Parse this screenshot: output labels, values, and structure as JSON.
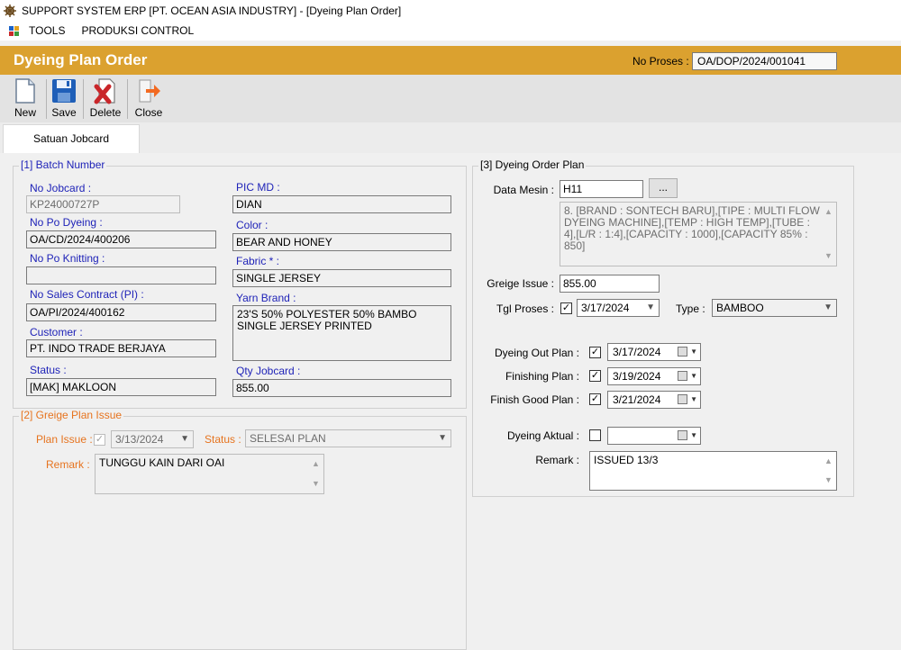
{
  "window": {
    "title": "SUPPORT SYSTEM ERP [PT. OCEAN ASIA INDUSTRY] - [Dyeing Plan Order]"
  },
  "menu": {
    "items": [
      "TOOLS",
      "PRODUKSI CONTROL"
    ]
  },
  "header": {
    "title": "Dyeing Plan Order",
    "no_proses_label": "No Proses :",
    "no_proses_value": "OA/DOP/2024/001041"
  },
  "toolbar": {
    "new": "New",
    "save": "Save",
    "delete": "Delete",
    "close": "Close"
  },
  "tabs": [
    "Satuan Jobcard"
  ],
  "batch": {
    "legend": "[1] Batch Number",
    "no_jobcard_label": "No Jobcard :",
    "no_jobcard": "KP24000727P",
    "no_po_dyeing_label": "No Po Dyeing :",
    "no_po_dyeing": "OA/CD/2024/400206",
    "no_po_knitting_label": "No Po Knitting :",
    "no_po_knitting": "",
    "no_sales_contract_label": "No Sales Contract (PI) :",
    "no_sales_contract": "OA/PI/2024/400162",
    "customer_label": "Customer :",
    "customer": "PT. INDO TRADE BERJAYA",
    "status_label": "Status :",
    "status": "[MAK] MAKLOON",
    "pic_md_label": "PIC MD :",
    "pic_md": "DIAN",
    "color_label": "Color :",
    "color": "BEAR AND HONEY",
    "fabric_label": "Fabric * :",
    "fabric": "SINGLE JERSEY",
    "yarn_brand_label": "Yarn Brand :",
    "yarn_brand": "23'S 50% POLYESTER 50% BAMBO SINGLE JERSEY PRINTED",
    "qty_jobcard_label": "Qty Jobcard :",
    "qty_jobcard": "855.00"
  },
  "greige": {
    "legend": "[2] Greige Plan Issue",
    "plan_issue_label": "Plan Issue :",
    "plan_issue_date": "3/13/2024",
    "status_label": "Status :",
    "status_value": "SELESAI PLAN",
    "remark_label": "Remark :",
    "remark": "TUNGGU KAIN DARI OAI"
  },
  "dyeing": {
    "legend": "[3] Dyeing Order Plan",
    "data_mesin_label": "Data Mesin :",
    "data_mesin": "H11",
    "ellipsis": "...",
    "mesin_desc": "8. [BRAND :  SONTECH BARU],[TIPE : MULTI FLOW DYEING MACHINE],[TEMP : HIGH TEMP],[TUBE : 4],[L/R : 1:4],[CAPACITY : 1000],[CAPACITY 85% : 850]",
    "greige_issue_label": "Greige Issue :",
    "greige_issue": "855.00",
    "tgl_proses_label": "Tgl Proses :",
    "tgl_proses": "3/17/2024",
    "type_label": "Type :",
    "type_value": "BAMBOO",
    "dyeing_out_label": "Dyeing Out Plan :",
    "dyeing_out": "3/17/2024",
    "finishing_label": "Finishing Plan :",
    "finishing": "3/19/2024",
    "finish_good_label": "Finish Good Plan :",
    "finish_good": "3/21/2024",
    "dyeing_aktual_label": "Dyeing Aktual :",
    "dyeing_aktual": "",
    "remark_label": "Remark :",
    "remark": "ISSUED 13/3"
  },
  "colors": {
    "header_bg": "#dba12f",
    "label_blue": "#1f23b8",
    "label_orange": "#e6731e"
  }
}
